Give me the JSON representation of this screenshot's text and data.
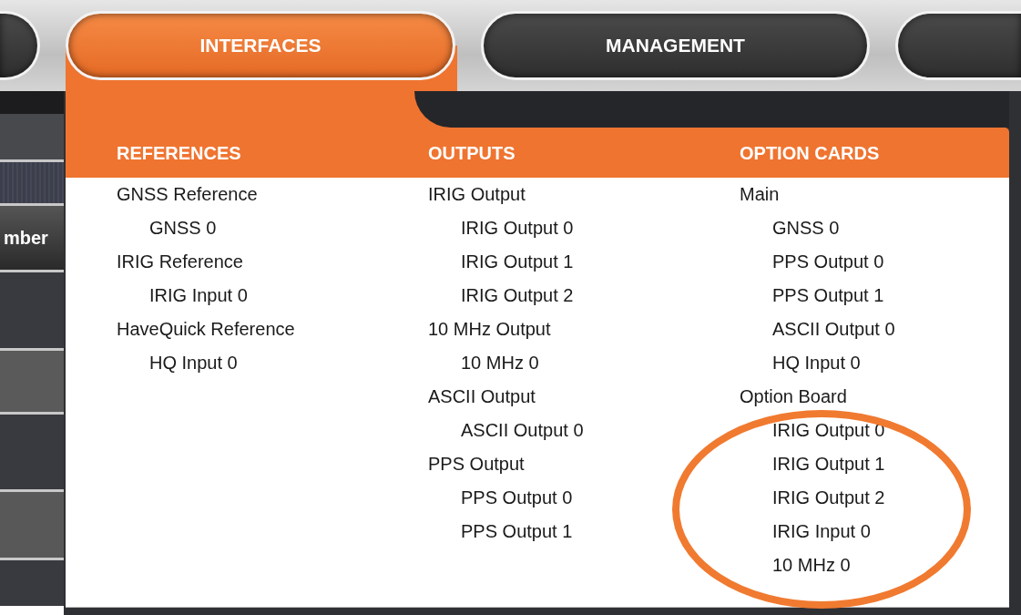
{
  "nav_tabs": [
    {
      "label": "INTERFACES",
      "selected": true
    },
    {
      "label": "MANAGEMENT",
      "selected": false
    }
  ],
  "table": {
    "column_header": "mber"
  },
  "menu": {
    "columns": [
      {
        "heading": "REFERENCES",
        "items": [
          {
            "label": "GNSS Reference",
            "children": [
              {
                "label": "GNSS 0"
              }
            ]
          },
          {
            "label": "IRIG Reference",
            "children": [
              {
                "label": "IRIG Input 0"
              }
            ]
          },
          {
            "label": "HaveQuick Reference",
            "children": [
              {
                "label": "HQ Input 0"
              }
            ]
          }
        ]
      },
      {
        "heading": "OUTPUTS",
        "items": [
          {
            "label": "IRIG Output",
            "children": [
              {
                "label": "IRIG Output 0"
              },
              {
                "label": "IRIG Output 1"
              },
              {
                "label": "IRIG Output 2"
              }
            ]
          },
          {
            "label": "10 MHz Output",
            "children": [
              {
                "label": "10 MHz 0"
              }
            ]
          },
          {
            "label": "ASCII Output",
            "children": [
              {
                "label": "ASCII Output 0"
              }
            ]
          },
          {
            "label": "PPS Output",
            "children": [
              {
                "label": "PPS Output 0"
              },
              {
                "label": "PPS Output 1"
              }
            ]
          }
        ]
      },
      {
        "heading": "OPTION CARDS",
        "items": [
          {
            "label": "Main",
            "children": [
              {
                "label": "GNSS 0"
              },
              {
                "label": "PPS Output 0"
              },
              {
                "label": "PPS Output 1"
              },
              {
                "label": "ASCII Output 0"
              },
              {
                "label": "HQ Input 0"
              }
            ]
          },
          {
            "label": "Option Board",
            "children": [
              {
                "label": "IRIG Output 0"
              },
              {
                "label": "IRIG Output 1"
              },
              {
                "label": "IRIG Output 2"
              },
              {
                "label": "IRIG Input 0"
              },
              {
                "label": "10 MHz 0"
              }
            ]
          }
        ]
      }
    ]
  }
}
